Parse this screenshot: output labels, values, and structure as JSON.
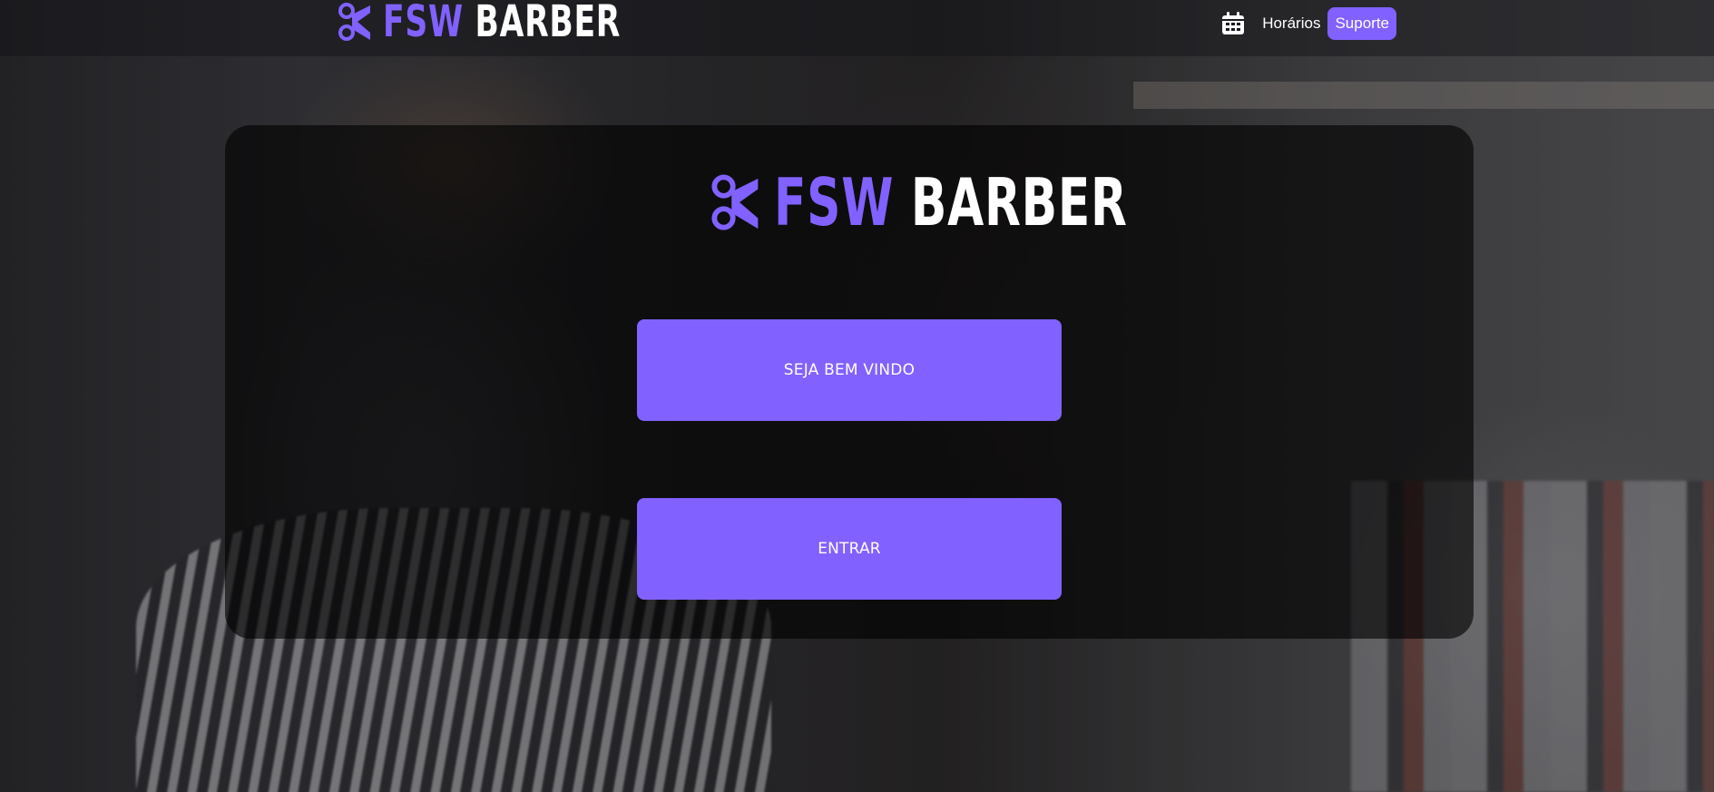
{
  "app": {
    "brand_primary": "FSW",
    "brand_secondary": "BARBER"
  },
  "colors": {
    "accent": "#8161ff",
    "text": "#ffffff"
  },
  "header": {
    "logo": {
      "icon": "scissors-logo-icon",
      "fsw": "FSW",
      "barber": "BARBER"
    },
    "nav": {
      "calendar_icon": "calendar-icon",
      "schedule_label": "Horários",
      "support_label": "Suporte"
    }
  },
  "main": {
    "logo": {
      "icon": "scissors-logo-icon",
      "fsw": "FSW",
      "barber": "BARBER"
    },
    "welcome_button": "SEJA BEM VINDO",
    "enter_button": "ENTRAR"
  }
}
